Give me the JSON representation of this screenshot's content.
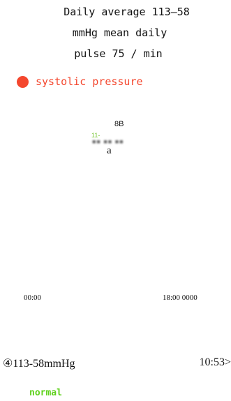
{
  "summary": {
    "line1": "Daily average 113–58",
    "line2": "mmHg mean daily",
    "line3": "pulse 75 / min"
  },
  "legend": {
    "label": "systolic pressure",
    "dot_color": "#f4472e"
  },
  "chart": {
    "label_top": "8B",
    "label_small": "11-",
    "label_small_color": "#7cc83a",
    "label_blur": "■■ ■■ ■■",
    "label_a": "a",
    "x_axis_left": "00:00",
    "x_axis_right": "18:00 0000"
  },
  "record": {
    "value": "④113-58mmHg",
    "time": "10:53>",
    "status": "normal",
    "status_color": "#5fd11d"
  }
}
